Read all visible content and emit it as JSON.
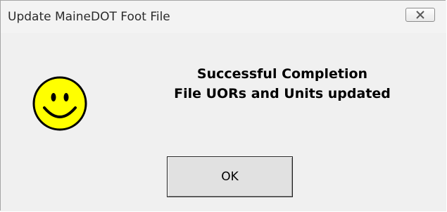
{
  "window": {
    "title": "Update MaineDOT Foot File"
  },
  "message": {
    "line1": "Successful Completion",
    "line2": "File UORs and Units updated"
  },
  "buttons": {
    "ok_label": "OK"
  },
  "icons": {
    "status_icon": "smiley-face-icon",
    "close_icon": "close-icon"
  },
  "colors": {
    "smiley_fill": "#ffff00",
    "dialog_background": "#f0f0f0"
  }
}
